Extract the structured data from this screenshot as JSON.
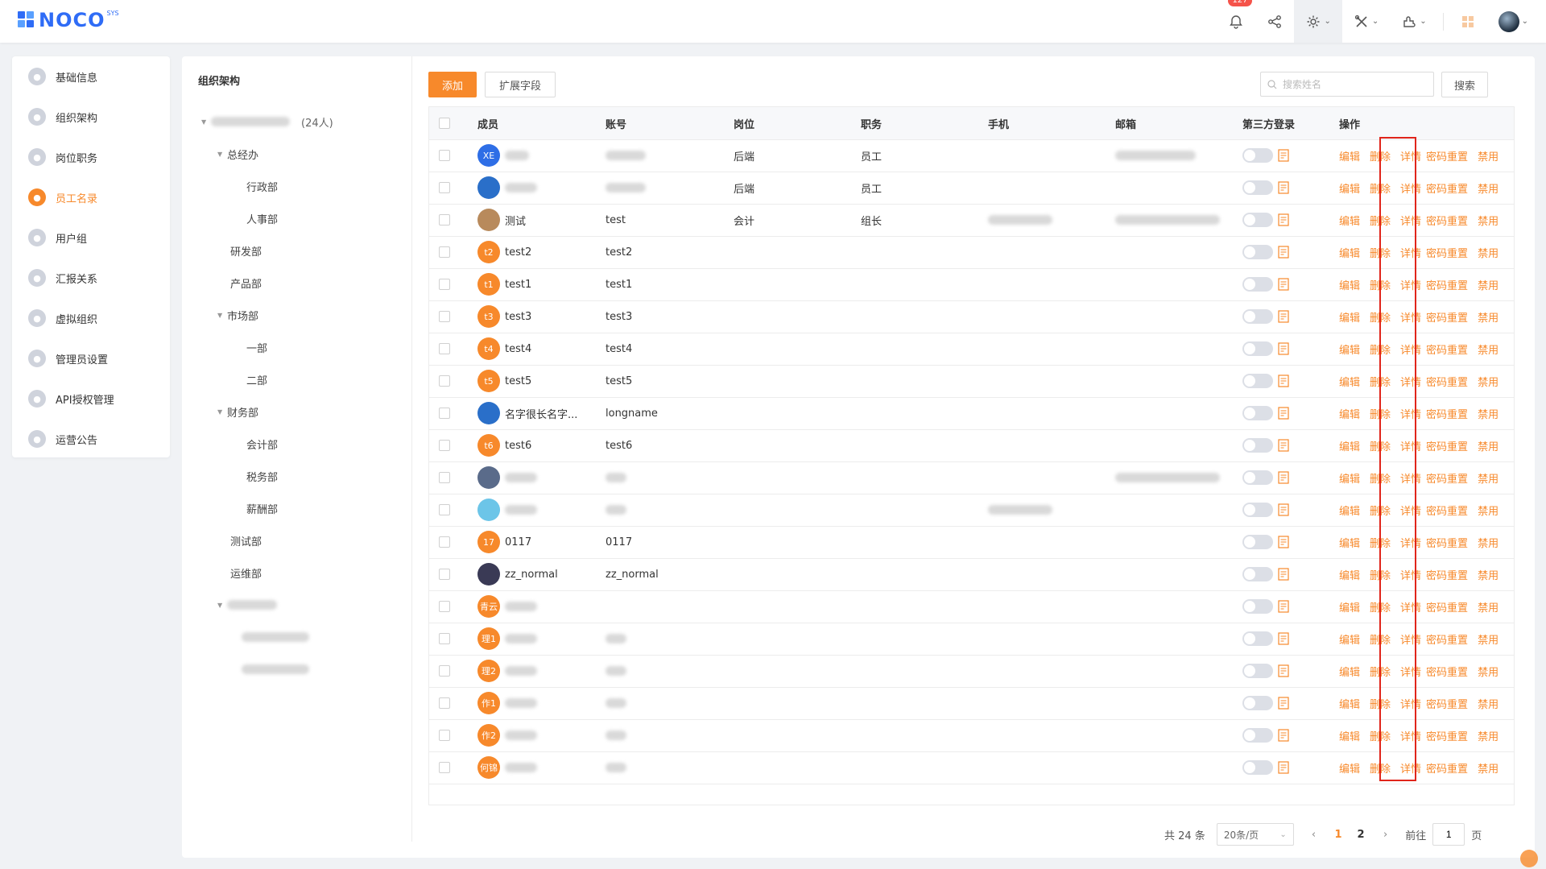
{
  "header": {
    "logo_text": "NOCO",
    "logo_sup": "SYS",
    "notification_count": "127",
    "icons": [
      "bell-icon",
      "share-icon",
      "gear-icon",
      "tools-icon",
      "plugin-icon",
      "apps-icon",
      "avatar"
    ]
  },
  "nav": {
    "items": [
      {
        "label": "基础信息",
        "icon": "info-icon",
        "active": false
      },
      {
        "label": "组织架构",
        "icon": "org-icon",
        "active": false
      },
      {
        "label": "岗位职务",
        "icon": "post-icon",
        "active": false
      },
      {
        "label": "员工名录",
        "icon": "staff-icon",
        "active": true
      },
      {
        "label": "用户组",
        "icon": "group-icon",
        "active": false
      },
      {
        "label": "汇报关系",
        "icon": "report-icon",
        "active": false
      },
      {
        "label": "虚拟组织",
        "icon": "virtual-org-icon",
        "active": false
      },
      {
        "label": "管理员设置",
        "icon": "admin-icon",
        "active": false
      },
      {
        "label": "API授权管理",
        "icon": "api-icon",
        "active": false
      },
      {
        "label": "运营公告",
        "icon": "notice-icon",
        "active": false
      }
    ]
  },
  "org": {
    "title": "组织架构",
    "root_count": "(24人)",
    "tree": [
      {
        "label": "总经办",
        "level": 1,
        "arrow": true
      },
      {
        "label": "行政部",
        "level": 2,
        "arrow": false
      },
      {
        "label": "人事部",
        "level": 2,
        "arrow": false
      },
      {
        "label": "研发部",
        "level": 1,
        "arrow": false
      },
      {
        "label": "产品部",
        "level": 1,
        "arrow": false
      },
      {
        "label": "市场部",
        "level": 1,
        "arrow": true
      },
      {
        "label": "一部",
        "level": 2,
        "arrow": false
      },
      {
        "label": "二部",
        "level": 2,
        "arrow": false
      },
      {
        "label": "财务部",
        "level": 1,
        "arrow": true
      },
      {
        "label": "会计部",
        "level": 2,
        "arrow": false
      },
      {
        "label": "税务部",
        "level": 2,
        "arrow": false
      },
      {
        "label": "薪酬部",
        "level": 2,
        "arrow": false
      },
      {
        "label": "测试部",
        "level": 1,
        "arrow": false
      },
      {
        "label": "运维部",
        "level": 1,
        "arrow": false
      }
    ]
  },
  "toolbar": {
    "add_label": "添加",
    "ext_label": "扩展字段",
    "search_placeholder": "搜索姓名",
    "search_label": "搜索"
  },
  "table": {
    "columns": [
      "成员",
      "账号",
      "岗位",
      "职务",
      "手机",
      "邮箱",
      "第三方登录",
      "操作"
    ],
    "actions": [
      "编辑",
      "删除",
      "详情",
      "密码重置",
      "禁用"
    ],
    "rows": [
      {
        "avatar": "XE",
        "name": "",
        "account": "",
        "post": "后端",
        "duty": "员工",
        "phone": "",
        "email": "",
        "blur_name": true,
        "blur_account": true,
        "blur_email": true
      },
      {
        "avatar": "",
        "name": "",
        "account": "",
        "post": "后端",
        "duty": "员工",
        "phone": "",
        "email": "",
        "blur_name": true,
        "blur_account": true
      },
      {
        "avatar": "",
        "name": "测试",
        "account": "test",
        "post": "会计",
        "duty": "组长",
        "phone": "",
        "email": "",
        "blur_phone": true,
        "blur_email": true
      },
      {
        "avatar": "t2",
        "name": "test2",
        "account": "test2"
      },
      {
        "avatar": "t1",
        "name": "test1",
        "account": "test1"
      },
      {
        "avatar": "t3",
        "name": "test3",
        "account": "test3"
      },
      {
        "avatar": "t4",
        "name": "test4",
        "account": "test4"
      },
      {
        "avatar": "t5",
        "name": "test5",
        "account": "test5"
      },
      {
        "avatar": "",
        "name": "名字很长名字...",
        "account": "longname"
      },
      {
        "avatar": "t6",
        "name": "test6",
        "account": "test6"
      },
      {
        "avatar": "",
        "name": "",
        "account": "",
        "blur_name": true,
        "blur_account": true,
        "blur_email": true
      },
      {
        "avatar": "",
        "name": "",
        "account": "",
        "blur_name": true,
        "blur_account": true,
        "blur_phone": true
      },
      {
        "avatar": "17",
        "name": "0117",
        "account": "0117"
      },
      {
        "avatar": "",
        "name": "zz_normal",
        "account": "zz_normal"
      },
      {
        "avatar": "青云",
        "name": "",
        "account": "",
        "blur_name": true
      },
      {
        "avatar": "理1",
        "name": "",
        "account": "",
        "blur_name": true,
        "blur_account": true
      },
      {
        "avatar": "理2",
        "name": "",
        "account": "",
        "blur_name": true,
        "blur_account": true
      },
      {
        "avatar": "作1",
        "name": "",
        "account": "",
        "blur_name": true,
        "blur_account": true
      },
      {
        "avatar": "作2",
        "name": "",
        "account": "",
        "blur_name": true,
        "blur_account": true
      },
      {
        "avatar": "何锦",
        "name": "",
        "account": "",
        "blur_name": true,
        "blur_account": true
      }
    ]
  },
  "pagination": {
    "total": "共 24 条",
    "page_size": "20条/页",
    "pages": [
      "1",
      "2"
    ],
    "current": "1",
    "goto_label": "前往",
    "goto_value": "1",
    "page_suffix": "页"
  },
  "colors": {
    "accent": "#f7892b",
    "brand": "#2f6cf6",
    "highlight": "#e0251b"
  }
}
